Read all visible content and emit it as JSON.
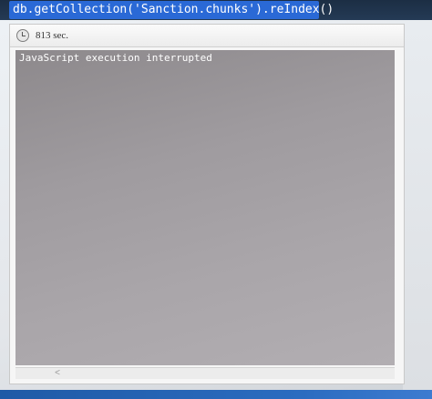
{
  "query": {
    "command": "db.getCollection('Sanction.chunks').reIndex()"
  },
  "result": {
    "elapsed": "813 sec.",
    "clock_icon": "clock-icon",
    "output": "JavaScript execution interrupted"
  },
  "scrollbar": {
    "left_arrow": "<"
  }
}
